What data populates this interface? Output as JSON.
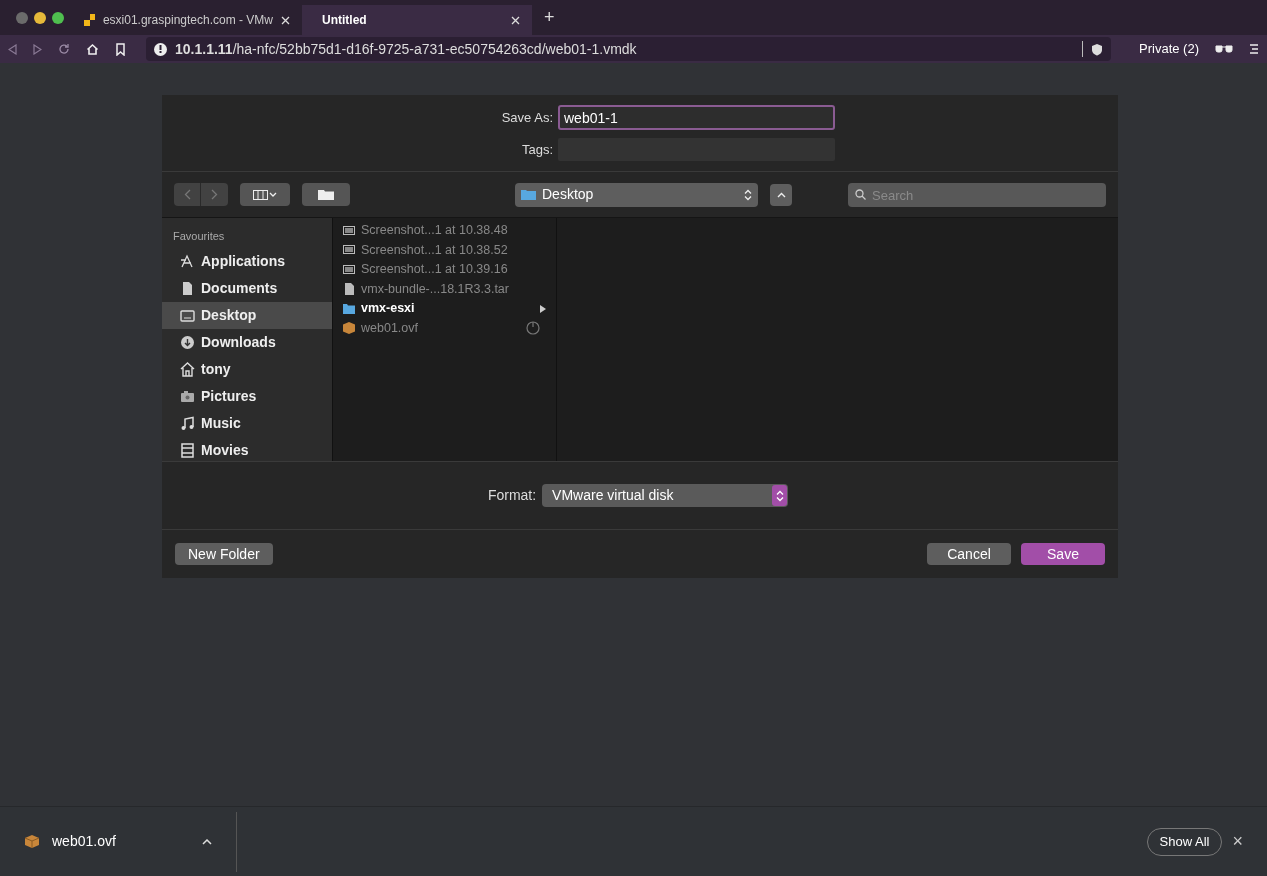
{
  "tabs": [
    {
      "title": "esxi01.graspingtech.com - VMw",
      "selected": false
    },
    {
      "title": "Untitled",
      "selected": true
    }
  ],
  "new_tab": "+",
  "address": "**10.1.1.11**/ha-nfc/52bb75d1-d16f-9725-a731-ec50754263cd/web01-1.vmdk",
  "private_label": "Private (2)",
  "dialog": {
    "save_as_label": "Save As:",
    "save_as_value": "web01-1",
    "tags_label": "Tags:",
    "location": "Desktop",
    "search_placeholder": "Search",
    "sidebar_heading": "Favourites",
    "sidebar_items": [
      {
        "label": "Applications",
        "kind": "apps",
        "selected": false
      },
      {
        "label": "Documents",
        "kind": "docs",
        "selected": false
      },
      {
        "label": "Desktop",
        "kind": "desktop",
        "selected": true
      },
      {
        "label": "Downloads",
        "kind": "downloads",
        "selected": false
      },
      {
        "label": "tony",
        "kind": "home",
        "selected": false
      },
      {
        "label": "Pictures",
        "kind": "pictures",
        "selected": false
      },
      {
        "label": "Music",
        "kind": "music",
        "selected": false
      },
      {
        "label": "Movies",
        "kind": "movies",
        "selected": false
      }
    ],
    "files": [
      {
        "name": "Screenshot...1 at 10.38.48",
        "kind": "image",
        "disabled": true
      },
      {
        "name": "Screenshot...1 at 10.38.52",
        "kind": "image",
        "disabled": true
      },
      {
        "name": "Screenshot...1 at 10.39.16",
        "kind": "image",
        "disabled": true
      },
      {
        "name": "vmx-bundle-...18.1R3.3.tar",
        "kind": "file",
        "disabled": true
      },
      {
        "name": "vmx-esxi",
        "kind": "folder",
        "disabled": false
      },
      {
        "name": "web01.ovf",
        "kind": "package",
        "disabled": true
      }
    ],
    "format_label": "Format:",
    "format_value": "VMware virtual disk",
    "new_folder": "New Folder",
    "cancel": "Cancel",
    "save": "Save"
  },
  "downloads": {
    "item": "web01.ovf",
    "show_all": "Show All",
    "close": "×"
  }
}
